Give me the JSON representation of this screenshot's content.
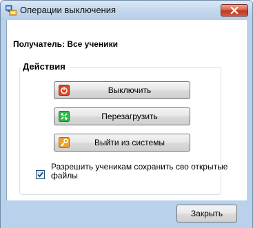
{
  "window": {
    "title": "Операции выключения",
    "app_icon": "computer-network-icon",
    "close_icon": "close-icon"
  },
  "recipient": {
    "text": "Получатель: Все ученики"
  },
  "actions": {
    "group_title": "Действия",
    "shutdown_label": "Выключить",
    "shutdown_icon": "power-icon",
    "restart_label": "Перезагрузить",
    "restart_icon": "restart-icon",
    "logoff_label": "Выйти из системы",
    "logoff_icon": "key-icon"
  },
  "option": {
    "checked": true,
    "label": "Разрешить ученикам сохранить сво открытые файлы"
  },
  "footer": {
    "close_label": "Закрыть"
  },
  "colors": {
    "title_bar": "#c4d8ee",
    "close_button": "#c0391f",
    "shutdown_icon": "#d9472b",
    "restart_icon": "#2fb84a",
    "logoff_icon": "#f0a030"
  }
}
